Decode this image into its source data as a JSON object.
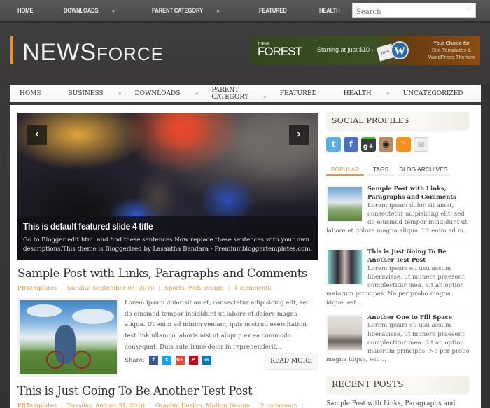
{
  "topbar": {
    "nav": [
      {
        "label": "HOME",
        "has_submenu": false
      },
      {
        "label": "DOWNLOADS",
        "has_submenu": true
      },
      {
        "label": "PARENT CATEGORY",
        "has_submenu": true
      },
      {
        "label": "FEATURED",
        "has_submenu": false
      },
      {
        "label": "HEALTH",
        "has_submenu": true
      }
    ],
    "submenu_glyph": "»",
    "search": {
      "placeholder": "Search",
      "icon": "search-icon"
    }
  },
  "header": {
    "logo_main": "NEWS",
    "logo_sub": "FORCE",
    "accent_color": "#e8952e",
    "ad": {
      "brand_small": "THEME",
      "brand": "FOREST",
      "price": "Starting at just $10 ›",
      "doc_label": "HTML",
      "wp_glyph": "W",
      "line1": "Your Choice for",
      "line2": "Site Templates &",
      "line3": "WordPress Themes"
    }
  },
  "mainnav": {
    "items": [
      {
        "label": "HOME",
        "has_submenu": false
      },
      {
        "label": "BUSINESS",
        "has_submenu": true
      },
      {
        "label": "DOWNLOADS",
        "has_submenu": true
      },
      {
        "label": "PARENT CATEGORY",
        "has_submenu": true
      },
      {
        "label": "FEATURED",
        "has_submenu": false
      },
      {
        "label": "HEALTH",
        "has_submenu": true
      },
      {
        "label": "UNCATEGORIZED",
        "has_submenu": false
      }
    ],
    "submenu_glyph": "»"
  },
  "slider": {
    "prev_glyph": "‹",
    "next_glyph": "›",
    "title": "This is default featured slide 4 title",
    "description": "Go to Blogger edit html and find these sentences.Now replace these sentences with your own descriptions.This theme is Bloggerized by Lasantha Bandara - Premiumbloggertemplates.com."
  },
  "posts": [
    {
      "title": "Sample Post with Links, Paragraphs and Comments",
      "author": "PBTemplates",
      "date": "Sunday, September 05, 2010",
      "labels": "Sports, Web Design",
      "comments": "4 comments",
      "excerpt": "Lorem ipsum dolor sit amet, consectetur adipisicing elit, sed do eiusmod tempor incididunt ut labore et dolore magna aliqua. Ut enim ad minim veniam, quis nostrud exercitation test link ullamco laboris nisi ut aliquip ex ea commodo consequat. Duis aute irure dolor in reprehenderit...",
      "share_label": "Share:",
      "share_buttons": [
        {
          "name": "facebook",
          "glyph": "f",
          "color": "#3b5998"
        },
        {
          "name": "twitter",
          "glyph": "t",
          "color": "#1da1f2"
        },
        {
          "name": "google-plus",
          "glyph": "G+",
          "color": "#dd4b39"
        },
        {
          "name": "pinterest",
          "glyph": "P",
          "color": "#bd081c"
        },
        {
          "name": "linkedin",
          "glyph": "in",
          "color": "#0077b5"
        }
      ],
      "read_more": "READ MORE"
    },
    {
      "title": "This is Just Going To Be Another Test Post",
      "author": "PBTemplates",
      "date": "Tuesday, August 31, 2010",
      "labels": "Graphic Design, Motion Design",
      "comments": "2 comments"
    }
  ],
  "sidebar": {
    "social_title": "SOCIAL PROFILES",
    "social_icons": [
      {
        "name": "twitter",
        "glyph": "t",
        "color": "#5eaee6"
      },
      {
        "name": "facebook",
        "glyph": "f",
        "color": "#4b6fc2"
      },
      {
        "name": "google-plus",
        "glyph": "g+",
        "color": "#3d3d3d"
      },
      {
        "name": "instagram",
        "glyph": "◉",
        "color": "#b98c63"
      },
      {
        "name": "rss",
        "glyph": "◝",
        "color": "#f39021"
      },
      {
        "name": "email",
        "glyph": "✉",
        "color": "#e8e8e8"
      }
    ],
    "tabs": [
      {
        "label": "POPULAR",
        "active": true
      },
      {
        "label": "TAGS",
        "active": false
      },
      {
        "label": "BLOG ARCHIVES",
        "active": false
      }
    ],
    "popular": [
      {
        "title": "Sample Post with Links, Paragraphs and Comments",
        "excerpt": "Lorem ipsum dolor sit amet, consectetur adipisicing elit, sed do eiusmod tempor incididunt ut labore et dolore magna aliqua. Ut enim ad m..."
      },
      {
        "title": "This is Just Going To Be Another Test Post",
        "excerpt": "Lorem ipsum eu usu assum liberavisse, ut munere praesent complectitur mea. Sit an option maiorum principes. Ne per probo magna idque, est ..."
      },
      {
        "title": "Another One to Fill Space",
        "excerpt": "Lorem ipsum eu usu assum liberavisse, ut munere praesent complectitur mea. Sit an option maiorum principes. Ne per probo magna idque, est ..."
      }
    ],
    "recent_title": "RECENT POSTS",
    "recent_first": "Sample Post with Links, Paragraphs and"
  }
}
